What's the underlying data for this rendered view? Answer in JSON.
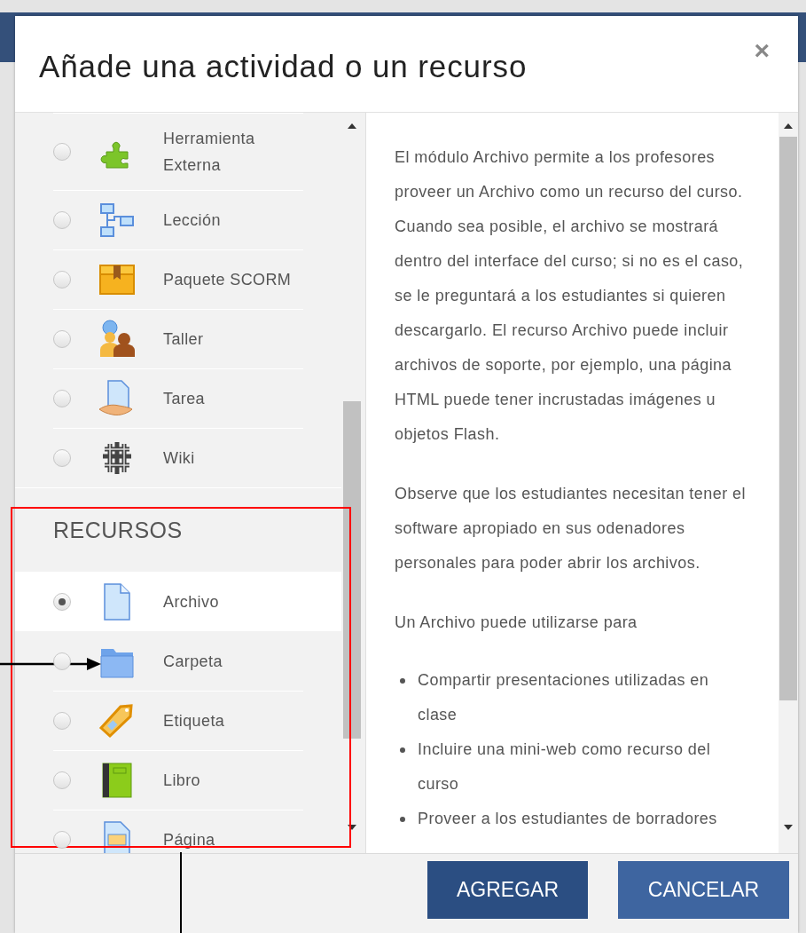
{
  "dialog": {
    "title": "Añade una actividad o un recurso",
    "close": "×"
  },
  "activities": [
    {
      "label": "Herramienta Externa",
      "selected": false
    },
    {
      "label": "Lección",
      "selected": false
    },
    {
      "label": "Paquete SCORM",
      "selected": false
    },
    {
      "label": "Taller",
      "selected": false
    },
    {
      "label": "Tarea",
      "selected": false
    },
    {
      "label": "Wiki",
      "selected": false
    }
  ],
  "resources_heading": "RECURSOS",
  "resources": [
    {
      "label": "Archivo",
      "selected": true
    },
    {
      "label": "Carpeta",
      "selected": false
    },
    {
      "label": "Etiqueta",
      "selected": false
    },
    {
      "label": "Libro",
      "selected": false
    },
    {
      "label": "Página",
      "selected": false
    }
  ],
  "description": {
    "paragraphs": [
      "El módulo Archivo permite a los profesores proveer un Archivo como un recurso del curso. Cuando sea posible, el archivo se mostrará dentro del interface del curso; si no es el caso, se le preguntará a los estudiantes si quieren descargarlo. El recurso Archivo puede incluir archivos de soporte, por ejemplo, una página HTML puede tener incrustadas imágenes u objetos Flash.",
      "Observe que los estudiantes necesitan tener el software apropiado en sus odenadores personales para poder abrir los archivos.",
      "Un Archivo puede utilizarse para"
    ],
    "bullets": [
      "Compartir presentaciones utilizadas en clase",
      "Incluire una mini-web como recurso del curso",
      "Proveer a los estudiantes de borradores"
    ]
  },
  "buttons": [
    {
      "label": "AGREGAR",
      "kind": "primary"
    },
    {
      "label": "CANCELAR",
      "kind": "secondary"
    }
  ]
}
